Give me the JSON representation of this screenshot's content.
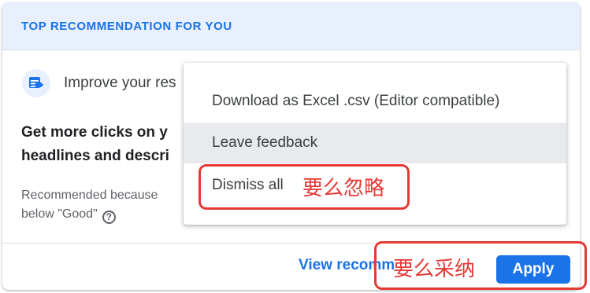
{
  "header": {
    "title": "TOP RECOMMENDATION FOR YOU"
  },
  "recommendation": {
    "title": "Improve your res",
    "body_line1": "Get more clicks on y",
    "body_line2": "headlines and descri",
    "reason_line1": "Recommended because",
    "reason_line2": "below \"Good\"",
    "help_icon_glyph": "?"
  },
  "footer": {
    "view_label": "View recomm",
    "apply_label": "Apply"
  },
  "menu": {
    "items": [
      {
        "label": "Download as Excel .csv (Editor compatible)"
      },
      {
        "label": "Leave feedback"
      },
      {
        "label": "Dismiss all"
      }
    ]
  },
  "annotations": {
    "dismiss_note": "要么忽略",
    "apply_note": "要么采纳",
    "color": "#e53935"
  },
  "colors": {
    "accent": "#1a73e8",
    "header_bg": "#e8f0fe"
  }
}
